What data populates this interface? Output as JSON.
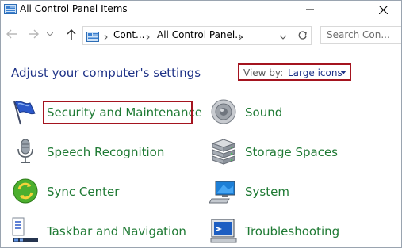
{
  "window": {
    "title": "All Control Panel Items"
  },
  "address": {
    "crumbs": [
      "Cont...",
      "All Control Panel..."
    ]
  },
  "search": {
    "placeholder": "Search Con..."
  },
  "header": {
    "heading": "Adjust your computer's settings",
    "view_by_label": "View by:",
    "view_by_value": "Large icons"
  },
  "items": [
    {
      "label": "Security and Maintenance",
      "icon": "flag-icon"
    },
    {
      "label": "Sound",
      "icon": "speaker-icon"
    },
    {
      "label": "Speech Recognition",
      "icon": "microphone-icon"
    },
    {
      "label": "Storage Spaces",
      "icon": "storage-drives-icon"
    },
    {
      "label": "Sync Center",
      "icon": "sync-icon"
    },
    {
      "label": "System",
      "icon": "monitor-icon"
    },
    {
      "label": "Taskbar and Navigation",
      "icon": "taskbar-icon"
    },
    {
      "label": "Troubleshooting",
      "icon": "troubleshoot-icon"
    }
  ],
  "colors": {
    "heading": "#1e3287",
    "item_text": "#1f7a34",
    "highlight": "#a4141f"
  }
}
